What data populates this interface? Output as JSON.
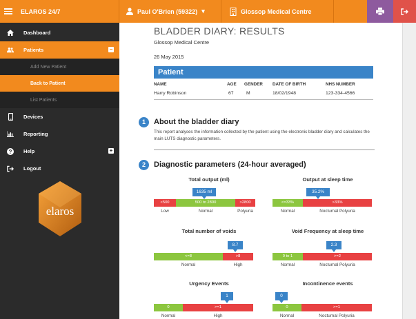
{
  "app": {
    "brand": "ELAROS 24/7",
    "user": "Paul O'Brien (59322)",
    "centre": "Glossop Medical Centre",
    "logo_text": "elaros"
  },
  "sidebar": {
    "items": [
      {
        "label": "Dashboard",
        "icon": "home-icon"
      },
      {
        "label": "Patients",
        "icon": "users-icon",
        "toggle": "−"
      },
      {
        "label": "Devices",
        "icon": "mobile-icon"
      },
      {
        "label": "Reporting",
        "icon": "bar-chart-icon"
      },
      {
        "label": "Help",
        "icon": "question-icon",
        "toggle": "+"
      },
      {
        "label": "Logout",
        "icon": "sign-out-icon"
      }
    ],
    "sub_items": [
      "Add New Patient",
      "Back to Patient",
      "List Patients"
    ]
  },
  "report": {
    "title": "BLADDER DIARY: RESULTS",
    "centre": "Glossop Medical Centre",
    "date": "26 May 2015",
    "patient_header": "Patient",
    "cols": [
      "NAME",
      "AGE",
      "GENDER",
      "DATE OF BIRTH",
      "NHS NUMBER"
    ],
    "values": [
      "Harry Robinson",
      "67",
      "M",
      "18/02/1948",
      "123-334-4566"
    ],
    "s1_num": "1",
    "s1_title": "About the bladder diary",
    "s1_text": "This report analyses the information collected by the patient using the electronic bladder diary and calculates the main LUTS diagnostic parameters.",
    "s2_num": "2",
    "s2_title": "Diagnostic parameters (24-hour averaged)"
  },
  "gauges": {
    "g1": {
      "title": "Total output (ml)",
      "value": "1635 ml",
      "segs": [
        "<500",
        "500 to 2800",
        ">2800"
      ],
      "labels": [
        "Low",
        "Normal",
        "Polyuria"
      ]
    },
    "g2": {
      "title": "Output at sleep time",
      "value": "35.2%",
      "segs": [
        "<=33%",
        ">33%"
      ],
      "labels": [
        "Normal",
        "Nocturnal Polyuria"
      ]
    },
    "g3": {
      "title": "Total number of voids",
      "value": "8.7",
      "segs": [
        "<=8",
        ">8"
      ],
      "labels": [
        "Normal",
        "High"
      ]
    },
    "g4": {
      "title": "Void Frequency at sleep time",
      "value": "2.3",
      "segs": [
        "0 to 1",
        ">=2"
      ],
      "labels": [
        "Normal",
        "Nocturnal Polyuria"
      ]
    },
    "g5": {
      "title": "Urgency Events",
      "value": "1",
      "segs": [
        "0",
        ">=1"
      ],
      "labels": [
        "Normal",
        "High"
      ]
    },
    "g6": {
      "title": "Incontinence events",
      "value": "0",
      "segs": [
        "0",
        ">=1"
      ],
      "labels": [
        "Normal",
        "Nocturnal Polyuria"
      ]
    }
  },
  "colors": {
    "accent": "#f28a1e",
    "blue": "#3a84c8",
    "green": "#8cc63f",
    "red": "#e84142"
  }
}
